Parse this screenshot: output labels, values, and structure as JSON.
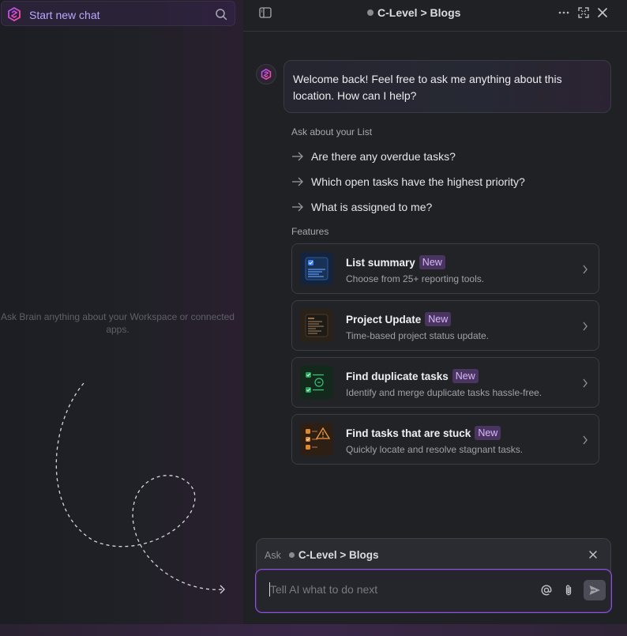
{
  "sidebar": {
    "start_chat_label": "Start new chat",
    "empty_hint": "Ask Brain anything about your Workspace or connected apps."
  },
  "header": {
    "breadcrumb": "C-Level > Blogs"
  },
  "chat": {
    "welcome": "Welcome back! Feel free to ask me anything about this location. How can I help?",
    "ask_title": "Ask about your List",
    "suggestions": [
      "Are there any overdue tasks?",
      "Which open tasks have the highest priority?",
      "What is assigned to me?"
    ],
    "features_title": "Features",
    "features": [
      {
        "title": "List summary",
        "badge": "New",
        "desc": "Choose from 25+ reporting tools."
      },
      {
        "title": "Project Update",
        "badge": "New",
        "desc": "Time-based project status update."
      },
      {
        "title": "Find duplicate tasks",
        "badge": "New",
        "desc": "Identify and merge duplicate tasks hassle-free."
      },
      {
        "title": "Find tasks that are stuck",
        "badge": "New",
        "desc": "Quickly locate and resolve stagnant tasks."
      }
    ]
  },
  "composer": {
    "ask_label": "Ask",
    "context": "C-Level > Blogs",
    "placeholder": "Tell AI what to do next",
    "value": ""
  },
  "colors": {
    "accent": "#8b52d8",
    "brand_pink": "#e040a0",
    "badge_bg": "#4a3560",
    "badge_text": "#d8b8ff"
  },
  "icons": [
    "brain-logo-icon",
    "search-icon",
    "sidebar-toggle-icon",
    "more-icon",
    "expand-icon",
    "close-icon",
    "arrow-right-icon",
    "chevron-right-icon",
    "at-mention-icon",
    "attachment-icon",
    "send-icon"
  ]
}
